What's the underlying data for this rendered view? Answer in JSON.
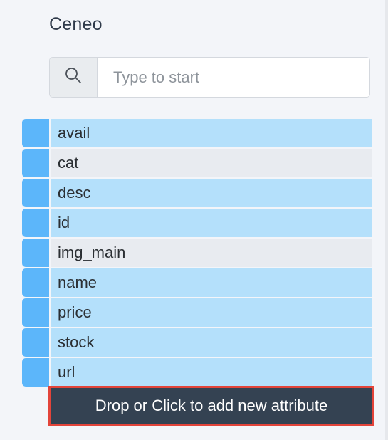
{
  "header": {
    "title": "Ceneo"
  },
  "search": {
    "placeholder": "Type to start",
    "icon": "search-icon"
  },
  "attributes": [
    {
      "label": "avail",
      "state": "active"
    },
    {
      "label": "cat",
      "state": "muted"
    },
    {
      "label": "desc",
      "state": "active"
    },
    {
      "label": "id",
      "state": "active"
    },
    {
      "label": "img_main",
      "state": "muted"
    },
    {
      "label": "name",
      "state": "active"
    },
    {
      "label": "price",
      "state": "active"
    },
    {
      "label": "stock",
      "state": "active"
    },
    {
      "label": "url",
      "state": "active"
    }
  ],
  "add_button": {
    "label": "Drop or Click to add new attribute",
    "highlight_color": "#e3443a"
  },
  "colors": {
    "handle": "#5cb6fa",
    "row_active": "#b4e0fb",
    "row_muted": "#e8ebf0",
    "button_bg": "#344252"
  }
}
